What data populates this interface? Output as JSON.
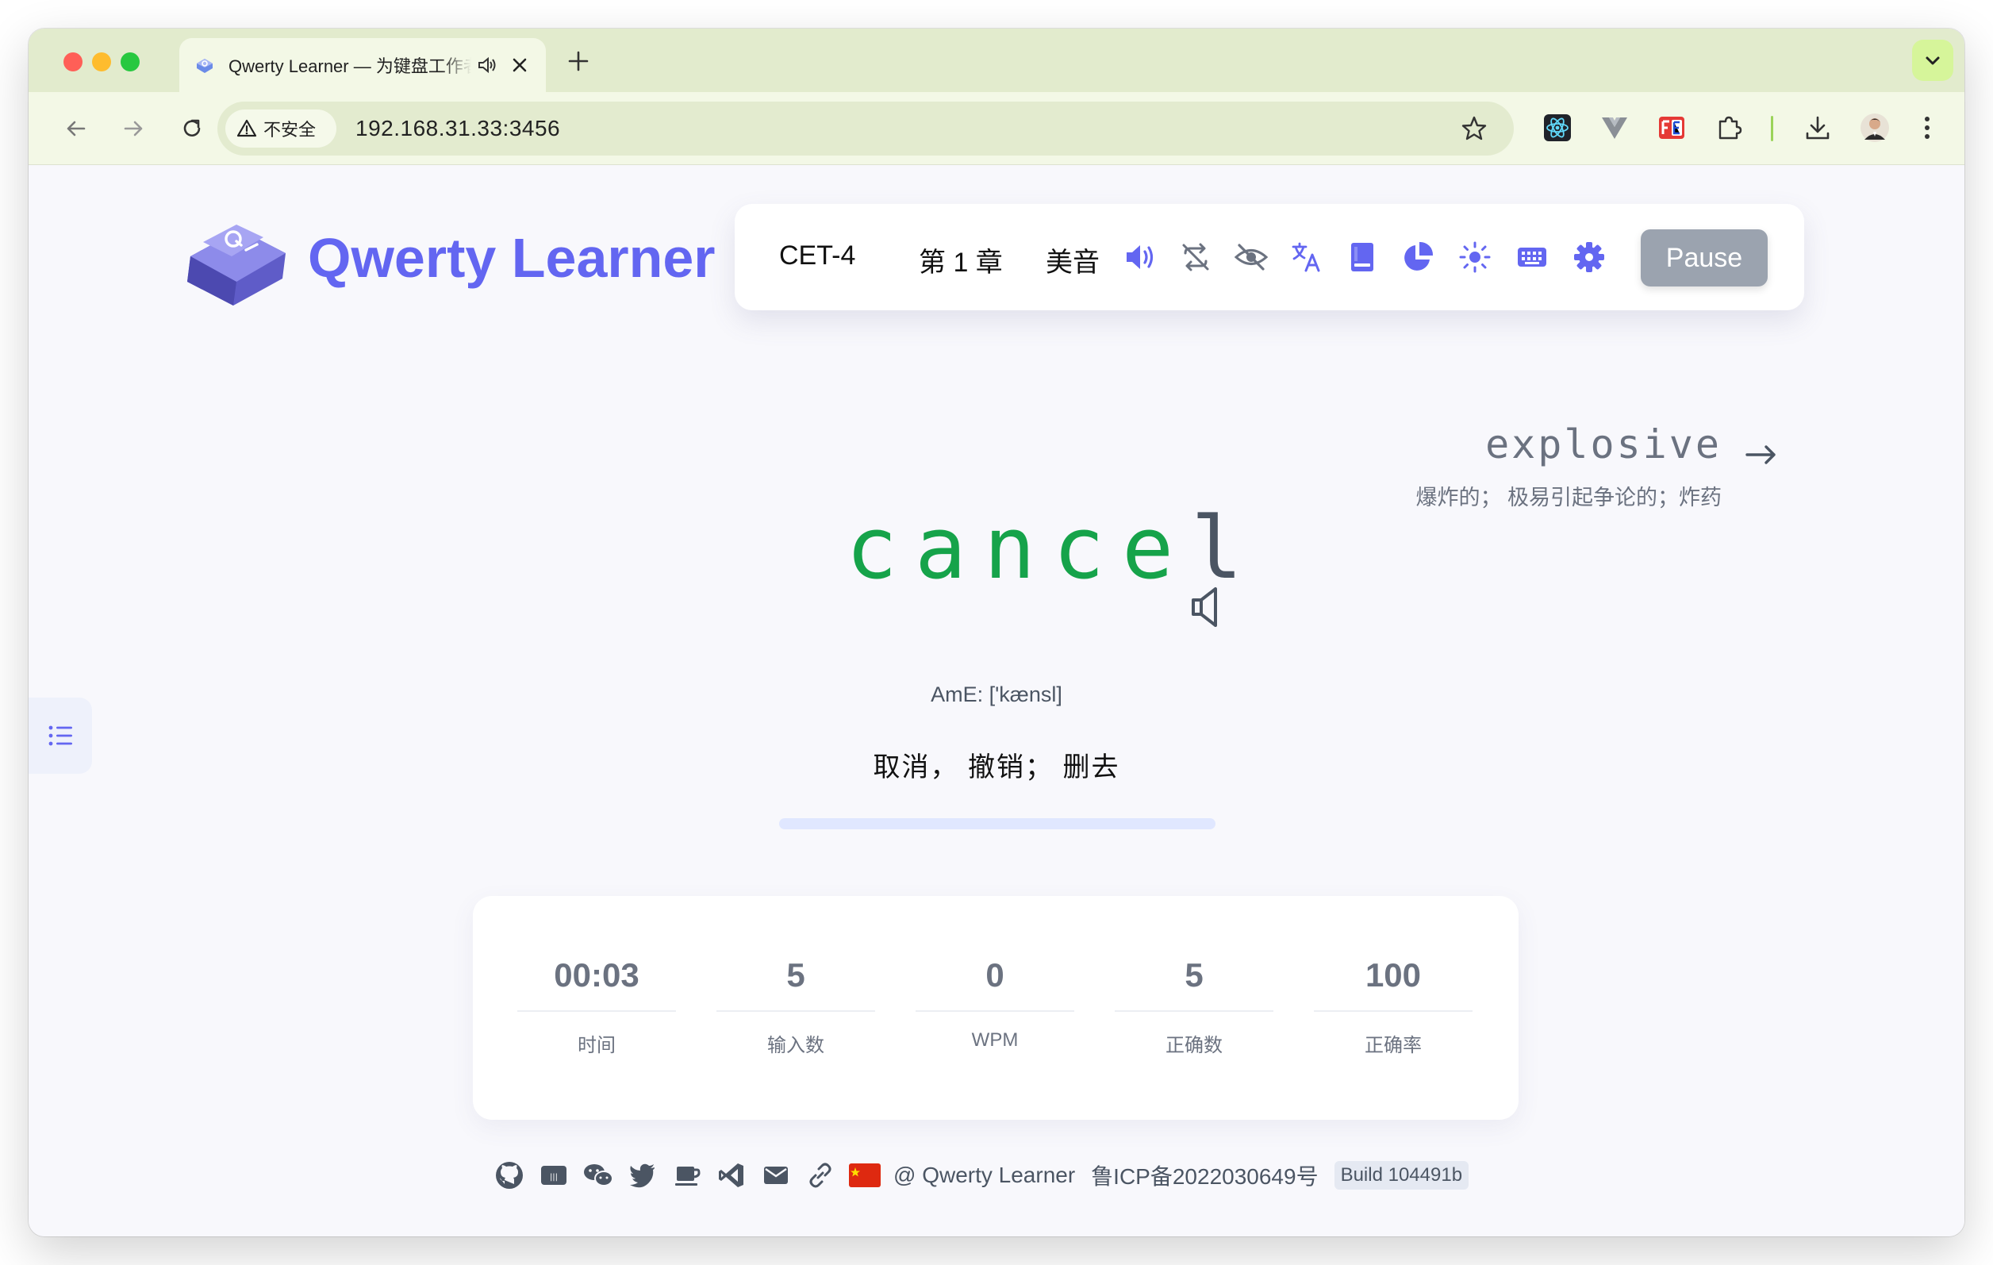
{
  "browser": {
    "tab_title": "Qwerty Learner — 为键盘工作者设计的单词与肌肉记忆锻炼软件",
    "security_label": "不安全",
    "url": "192.168.31.33:3456"
  },
  "app": {
    "brand": "Qwerty Learner",
    "dictionary": "CET-4",
    "chapter": "第 1 章",
    "accent": "美音",
    "pause_label": "Pause",
    "accent_color": "#6366f1"
  },
  "next_word": {
    "word": "explosive",
    "translation": "爆炸的；  极易引起争论的；炸药"
  },
  "current_word": {
    "typed": "cance",
    "remaining": "l",
    "phonetic": "AmE: ['kænsl]",
    "translation": "取消，  撤销；  删去"
  },
  "stats": [
    {
      "value": "00:03",
      "label": "时间"
    },
    {
      "value": "5",
      "label": "输入数"
    },
    {
      "value": "0",
      "label": "WPM"
    },
    {
      "value": "5",
      "label": "正确数"
    },
    {
      "value": "100",
      "label": "正确率"
    }
  ],
  "footer": {
    "copyright": "@ Qwerty Learner",
    "icp": "鲁ICP备2022030649号",
    "build": "Build 104491b"
  },
  "colors": {
    "typed": "#16a34a",
    "tab_strip": "#e2ebcd",
    "pause": "#9ba3af"
  }
}
